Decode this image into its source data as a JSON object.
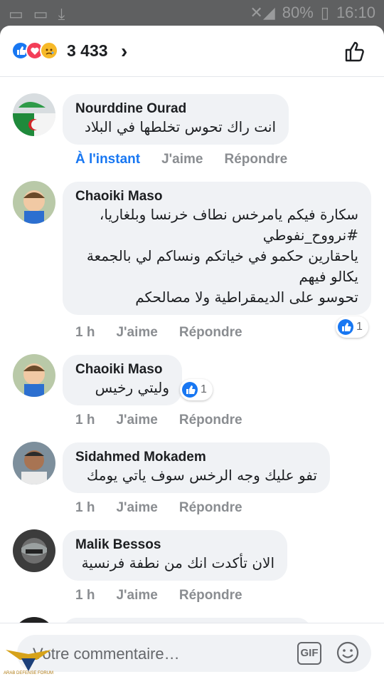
{
  "status": {
    "battery": "80%",
    "time": "16:10"
  },
  "header": {
    "reaction_count": "3 433",
    "chevron": "›",
    "icons": [
      "like-icon",
      "love-icon",
      "sad-icon",
      "thumbs-up-icon"
    ]
  },
  "comments": [
    {
      "name": "Nourddine Ourad",
      "text": "انت راك تحوس تخلطها في البلاد",
      "time": "À l'instant",
      "like": "J'aime",
      "reply": "Répondre"
    },
    {
      "name": "Chaoiki Maso",
      "text": "سكارة فيكم يامرخس نطاف خرنسا وبلغاريا،\n#نرووح_نفوطي\nياحقارين حكمو في خياتكم ونساكم لي بالجمعة يكالو فيهم\nتحوسو على الديمقراطية ولا مصالحكم",
      "time": "1 h",
      "like": "J'aime",
      "reply": "Répondre",
      "reactions": "1"
    },
    {
      "name": "Chaoiki Maso",
      "text": "وليتي رخيس",
      "time": "1 h",
      "like": "J'aime",
      "reply": "Répondre",
      "reactions": "1"
    },
    {
      "name": "Sidahmed Mokadem",
      "text": "تفو عليك وجه الرخس سوف ياتي يومك",
      "time": "1 h",
      "like": "J'aime",
      "reply": "Répondre"
    },
    {
      "name": "Malik Bessos",
      "text": "الان تأكدت انك من نطفة فرنسية",
      "time": "1 h",
      "like": "J'aime",
      "reply": "Répondre"
    }
  ],
  "composer": {
    "placeholder": "Votre commentaire…",
    "gif_label": "GIF"
  },
  "watermark": {
    "text": "ARAB DEFENSE FORUM"
  }
}
